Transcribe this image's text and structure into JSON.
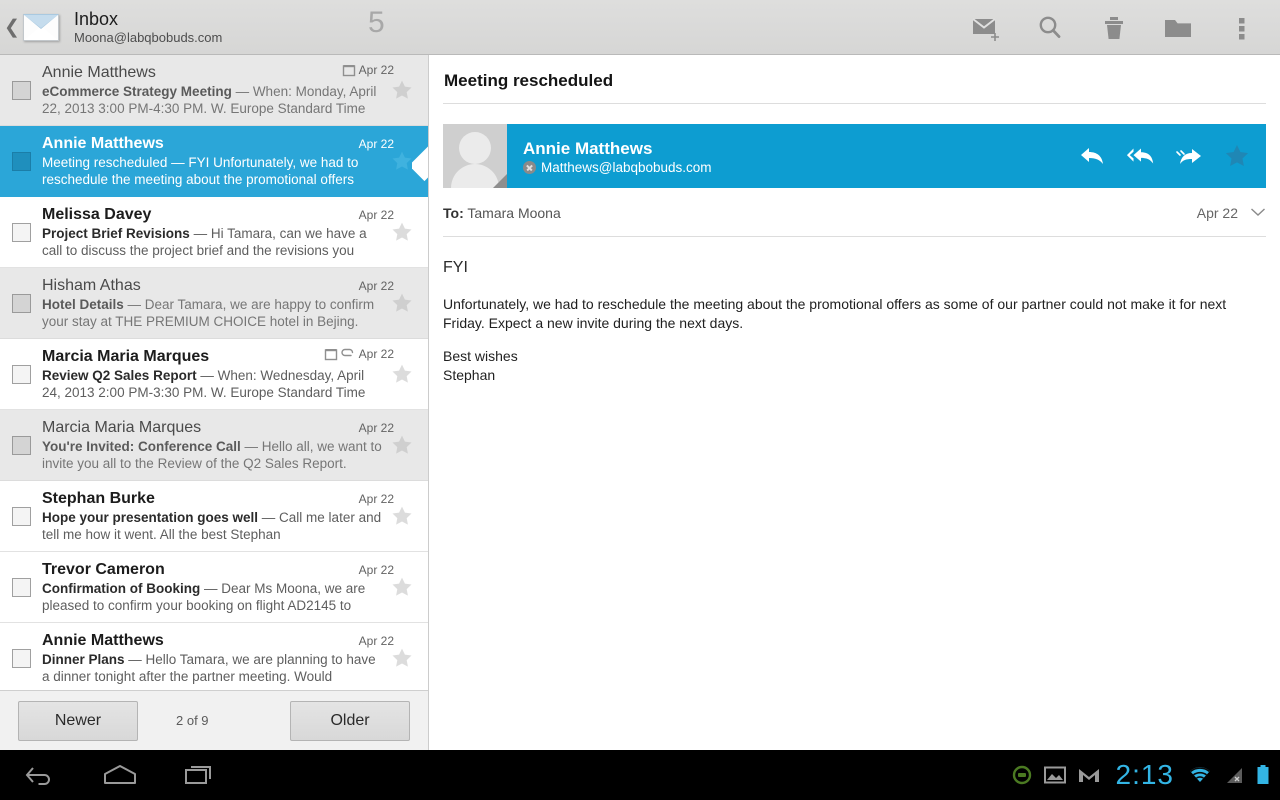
{
  "actionbar": {
    "back_icon": "chevron-left-icon",
    "app_icon": "envelope-logo-icon",
    "title": "Inbox",
    "account": "Moona@labqbobuds.com",
    "unread_count": "5",
    "actions": [
      {
        "name": "compose",
        "icon": "compose-mail-icon"
      },
      {
        "name": "search",
        "icon": "search-icon"
      },
      {
        "name": "delete",
        "icon": "trash-icon"
      },
      {
        "name": "move-to-folder",
        "icon": "folder-icon"
      },
      {
        "name": "overflow",
        "icon": "overflow-menu-icon"
      }
    ]
  },
  "list": {
    "messages": [
      {
        "from": "Annie Matthews",
        "subject": "eCommerce Strategy Meeting",
        "snippet": " — When: Monday, April 22, 2013 3:00 PM-4:30 PM. W. Europe Standard Time",
        "date": "Apr 22",
        "state": "read",
        "has_calendar": true,
        "has_attachment": false,
        "starred": false
      },
      {
        "from": "Annie Matthews",
        "subject": "Meeting rescheduled",
        "snippet": " — FYI Unfortunately, we had to reschedule the meeting about the promotional offers",
        "date": "Apr 22",
        "state": "selected",
        "has_calendar": false,
        "has_attachment": false,
        "starred": false
      },
      {
        "from": "Melissa Davey",
        "subject": "Project Brief Revisions",
        "snippet": " — Hi Tamara, can we have a call to discuss the project brief and the revisions you",
        "date": "Apr 22",
        "state": "unread",
        "has_calendar": false,
        "has_attachment": false,
        "starred": false
      },
      {
        "from": "Hisham Athas",
        "subject": "Hotel Details",
        "snippet": " — Dear Tamara, we are happy to confirm your stay at THE PREMIUM CHOICE hotel in Bejing.",
        "date": "Apr 22",
        "state": "read",
        "has_calendar": false,
        "has_attachment": false,
        "starred": false
      },
      {
        "from": "Marcia Maria Marques",
        "subject": "Review Q2 Sales Report",
        "snippet": " — When: Wednesday, April 24, 2013 2:00 PM-3:30 PM. W. Europe Standard Time",
        "date": "Apr 22",
        "state": "unread",
        "has_calendar": true,
        "has_attachment": true,
        "starred": false
      },
      {
        "from": "Marcia Maria Marques",
        "subject": "You're Invited: Conference Call",
        "snippet": " — Hello all, we want to invite you all to the Review of the Q2 Sales Report.",
        "date": "Apr 22",
        "state": "read",
        "has_calendar": false,
        "has_attachment": false,
        "starred": false
      },
      {
        "from": "Stephan Burke",
        "subject": "Hope your presentation goes well",
        "snippet": " — Call me later and tell me how it went. All the best Stephan",
        "date": "Apr 22",
        "state": "unread",
        "has_calendar": false,
        "has_attachment": false,
        "starred": false
      },
      {
        "from": "Trevor Cameron",
        "subject": "Confirmation of Booking",
        "snippet": " — Dear Ms Moona, we are pleased to confirm your booking on flight AD2145 to",
        "date": "Apr 22",
        "state": "unread",
        "has_calendar": false,
        "has_attachment": false,
        "starred": false
      },
      {
        "from": "Annie Matthews",
        "subject": "Dinner Plans",
        "snippet": " — Hello Tamara, we are planning to have a dinner tonight after the partner meeting. Would",
        "date": "Apr 22",
        "state": "unread",
        "has_calendar": false,
        "has_attachment": false,
        "starred": false
      }
    ]
  },
  "pager": {
    "newer_label": "Newer",
    "position": "2 of 9",
    "older_label": "Older"
  },
  "detail": {
    "subject": "Meeting rescheduled",
    "sender_name": "Annie Matthews",
    "sender_email": "Matthews@labqbobuds.com",
    "presence_badge_icon": "contact-blocked-icon",
    "avatar_icon": "default-avatar-icon",
    "actions": [
      {
        "name": "reply",
        "icon": "reply-icon"
      },
      {
        "name": "reply-all",
        "icon": "reply-all-icon"
      },
      {
        "name": "forward",
        "icon": "forward-icon"
      },
      {
        "name": "star",
        "icon": "star-icon"
      }
    ],
    "to_label": "To:",
    "to_value": "Tamara Moona",
    "date": "Apr 22",
    "expand_icon": "chevron-down-icon",
    "body_heading": "FYI",
    "body_paragraph": "Unfortunately, we had to reschedule the meeting about the promotional offers as some of our partner could not make it for next Friday. Expect a new invite during the next days.",
    "body_signoff": "Best wishes",
    "body_signature": "Stephan"
  },
  "navbar": {
    "buttons": [
      {
        "name": "back",
        "icon": "android-back-icon"
      },
      {
        "name": "home",
        "icon": "android-home-icon"
      },
      {
        "name": "recents",
        "icon": "android-recents-icon"
      }
    ],
    "status": {
      "notification_icons": [
        {
          "name": "download-complete",
          "icon": "download-circle-icon"
        },
        {
          "name": "screenshot",
          "icon": "image-icon"
        },
        {
          "name": "gmail",
          "icon": "gmail-icon"
        }
      ],
      "clock": "2:13",
      "wifi_icon": "wifi-icon",
      "signal_icon": "no-signal-icon",
      "battery_icon": "battery-full-icon"
    }
  },
  "colors": {
    "selection_blue": "#2ba6d8",
    "banner_blue": "#0d9dd1",
    "clock_blue": "#33b5e5",
    "read_row_bg": "#e8e8e8"
  }
}
